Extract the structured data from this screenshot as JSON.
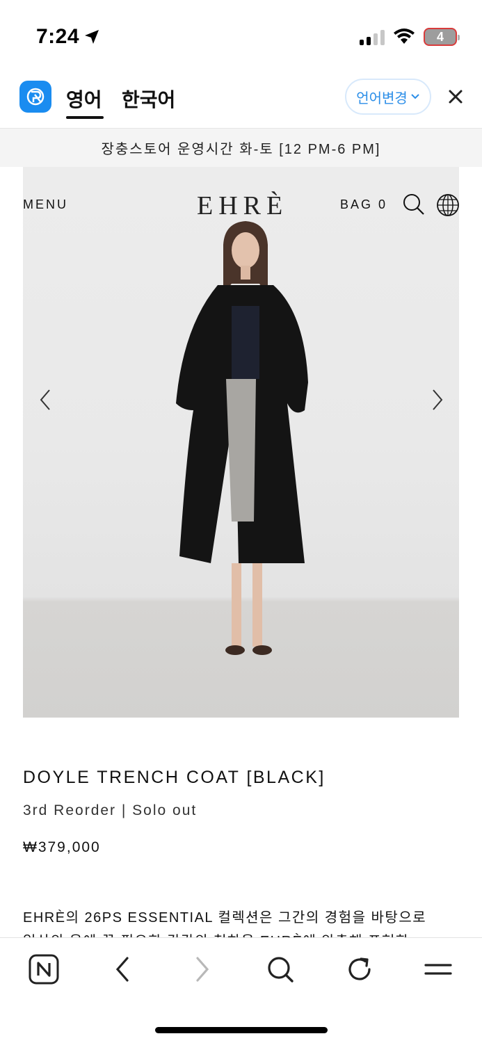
{
  "status_bar": {
    "time": "7:24",
    "battery_level": "4"
  },
  "translate_bar": {
    "tab_source": "영어",
    "tab_target": "한국어",
    "change_language": "언어변경"
  },
  "notice": {
    "text": "장충스토어 운영시간 화-토 [12 PM-6 PM]"
  },
  "site_header": {
    "menu_label": "MENU",
    "logo": "EHRÈ",
    "bag_label": "BAG 0"
  },
  "product": {
    "title": "DOYLE TRENCH COAT [BLACK]",
    "subtitle": "3rd Reorder | Solo out",
    "price": "₩379,000",
    "description_line1": "EHRÈ의 26PS ESSENTIAL 컬렉션은 그간의 경험을 바탕으로",
    "description_line2": "일상의 옷에 꼭 필요한 감각의 척하을 EHRÈ에 암축해 표현한"
  },
  "colors": {
    "accent": "#1a8cf0",
    "lang_change_text": "#2b8ee8",
    "notice_bg": "#f4f4f4"
  },
  "icons": {
    "location": "location-arrow-icon",
    "signal": "cellular-signal-icon",
    "wifi": "wifi-icon",
    "papago": "papago-logo-icon",
    "chevron": "chevron-down-icon",
    "close": "close-icon",
    "search": "search-icon",
    "globe": "globe-icon",
    "prev": "chevron-left-icon",
    "next": "chevron-right-icon",
    "naver": "naver-n-icon",
    "back": "back-arrow-icon",
    "forward": "forward-arrow-icon",
    "browser_search": "search-icon",
    "reload": "reload-icon",
    "menu": "hamburger-menu-icon"
  }
}
